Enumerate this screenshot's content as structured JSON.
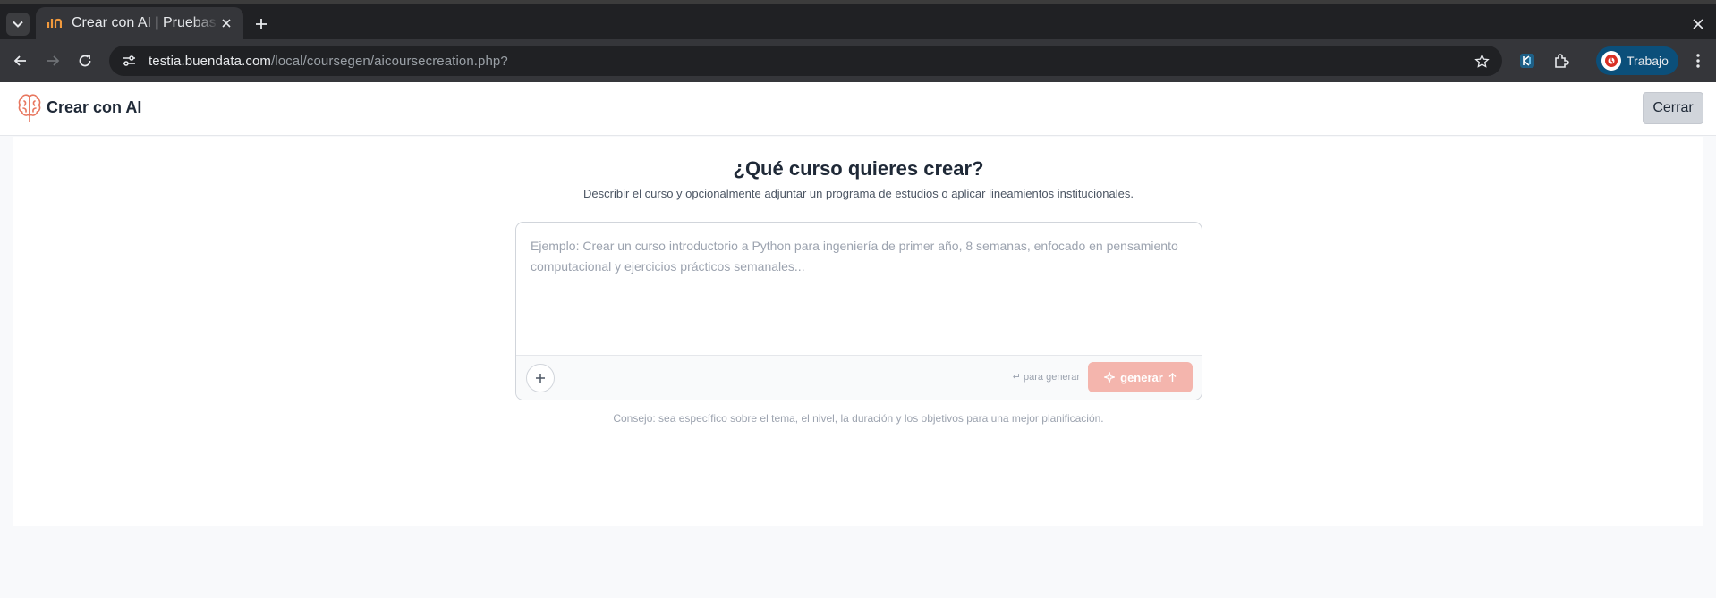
{
  "browser": {
    "tab_title": "Crear con AI | Pruebas",
    "url_host": "testia.buendata.com",
    "url_path": "/local/coursegen/aicoursecreation.php?",
    "profile_label": "Trabajo"
  },
  "header": {
    "title": "Crear con AI",
    "close_label": "Cerrar",
    "logo_icon": "brain-icon",
    "accent_color": "#e8775f"
  },
  "main": {
    "title": "¿Qué curso quieres crear?",
    "subtitle": "Describir el curso y opcionalmente adjuntar un programa de estudios o aplicar lineamientos institucionales.",
    "prompt_placeholder": "Ejemplo: Crear un curso introductorio a Python para ingeniería de primer año, 8 semanas, enfocado en pensamiento computacional y ejercicios prácticos semanales...",
    "prompt_value": "",
    "enter_hint": "↵ para generar",
    "generate_label": "generar",
    "generate_color": "#f4b5ad",
    "tip": "Consejo: sea específico sobre el tema, el nivel, la duración y los objetivos para una mejor planificación."
  }
}
